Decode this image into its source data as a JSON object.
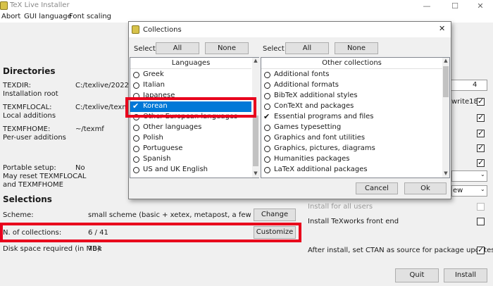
{
  "window": {
    "title": "TeX Live Installer",
    "controls": {
      "minimize": "—",
      "maximize": "☐",
      "close": "✕"
    }
  },
  "menu": [
    "Abort",
    "GUI language",
    "Font scaling"
  ],
  "directories": {
    "heading": "Directories",
    "texdir_label": "TEXDIR:",
    "texdir_desc": "Installation root",
    "texdir_value": "C:/texlive/2022",
    "texmflocal_label": "TEXMFLOCAL:",
    "texmflocal_desc": "Local additions",
    "texmflocal_value": "C:/texlive/texmf-l",
    "texmfhome_label": "TEXMFHOME:",
    "texmfhome_desc": "Per-user additions",
    "texmfhome_value": "~/texmf",
    "portable_label": "Portable setup:",
    "portable_desc1": "May reset TEXMFLOCAL",
    "portable_desc2": "and TEXMFHOME",
    "portable_value": "No"
  },
  "selections": {
    "heading": "Selections",
    "scheme_label": "Scheme:",
    "scheme_value": "small scheme (basic + xetex, metapost, a few languages)",
    "change_button": "Change",
    "collections_label": "N. of collections:",
    "collections_value": "6 / 41",
    "customize_button": "Customize",
    "disk_label": "Disk space required (in MB):",
    "disk_value": "704"
  },
  "right_panel": {
    "combo1_value": "4",
    "write18_label": "write18",
    "install_all_users": "Install for all users",
    "install_texworks": "Install TeXworks front end",
    "ctan_source": "After install, set CTAN as source for package updates",
    "combo3_value": "ew"
  },
  "bottom_buttons": {
    "quit": "Quit",
    "install": "Install"
  },
  "dialog": {
    "title": "Collections",
    "close": "✕",
    "select_label": "Select",
    "all_label": "All",
    "none_label": "None",
    "languages_header": "Languages",
    "other_header": "Other collections",
    "languages": [
      {
        "label": "Greek",
        "checked": false
      },
      {
        "label": "Italian",
        "checked": false
      },
      {
        "label": "Japanese",
        "checked": false
      },
      {
        "label": "Korean",
        "checked": true
      },
      {
        "label": "Other European languages",
        "checked": false
      },
      {
        "label": "Other languages",
        "checked": false
      },
      {
        "label": "Polish",
        "checked": false
      },
      {
        "label": "Portuguese",
        "checked": false
      },
      {
        "label": "Spanish",
        "checked": false
      },
      {
        "label": "US and UK English",
        "checked": false
      }
    ],
    "others": [
      {
        "label": "Additional fonts",
        "checked": false
      },
      {
        "label": "Additional formats",
        "checked": false
      },
      {
        "label": "BibTeX additional styles",
        "checked": false
      },
      {
        "label": "ConTeXt and packages",
        "checked": false
      },
      {
        "label": "Essential programs and files",
        "checked": true
      },
      {
        "label": "Games typesetting",
        "checked": false
      },
      {
        "label": "Graphics and font utilities",
        "checked": false
      },
      {
        "label": "Graphics, pictures, diagrams",
        "checked": false
      },
      {
        "label": "Humanities packages",
        "checked": false
      },
      {
        "label": "LaTeX additional packages",
        "checked": false
      }
    ],
    "cancel_button": "Cancel",
    "ok_button": "Ok"
  },
  "colors": {
    "highlight_red": "#e8001c",
    "selection_blue": "#0078d7"
  }
}
